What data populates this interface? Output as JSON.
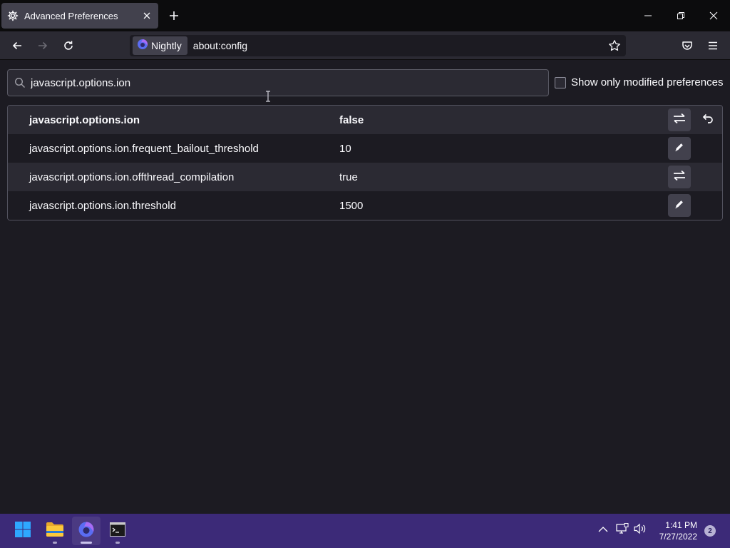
{
  "window": {
    "tab_title": "Advanced Preferences"
  },
  "navbar": {
    "identity_label": "Nightly",
    "url": "about:config"
  },
  "search": {
    "value": "javascript.options.ion"
  },
  "filter": {
    "modified_label": "Show only modified preferences",
    "checked": false
  },
  "prefs": [
    {
      "name": "javascript.options.ion",
      "value": "false",
      "type": "boolean",
      "modified": true
    },
    {
      "name": "javascript.options.ion.frequent_bailout_threshold",
      "value": "10",
      "type": "number",
      "modified": false
    },
    {
      "name": "javascript.options.ion.offthread_compilation",
      "value": "true",
      "type": "boolean",
      "modified": false
    },
    {
      "name": "javascript.options.ion.threshold",
      "value": "1500",
      "type": "number",
      "modified": false
    }
  ],
  "taskbar": {
    "time": "1:41 PM",
    "date": "7/27/2022",
    "notification_count": "2"
  },
  "icons": {
    "tab": "gear-icon",
    "toggle": "toggle-arrows-icon",
    "edit": "pencil-icon",
    "reset": "undo-icon"
  },
  "colors": {
    "background": "#1c1b22",
    "toolbar": "#2b2a33",
    "taskbar": "#3c2a78"
  }
}
